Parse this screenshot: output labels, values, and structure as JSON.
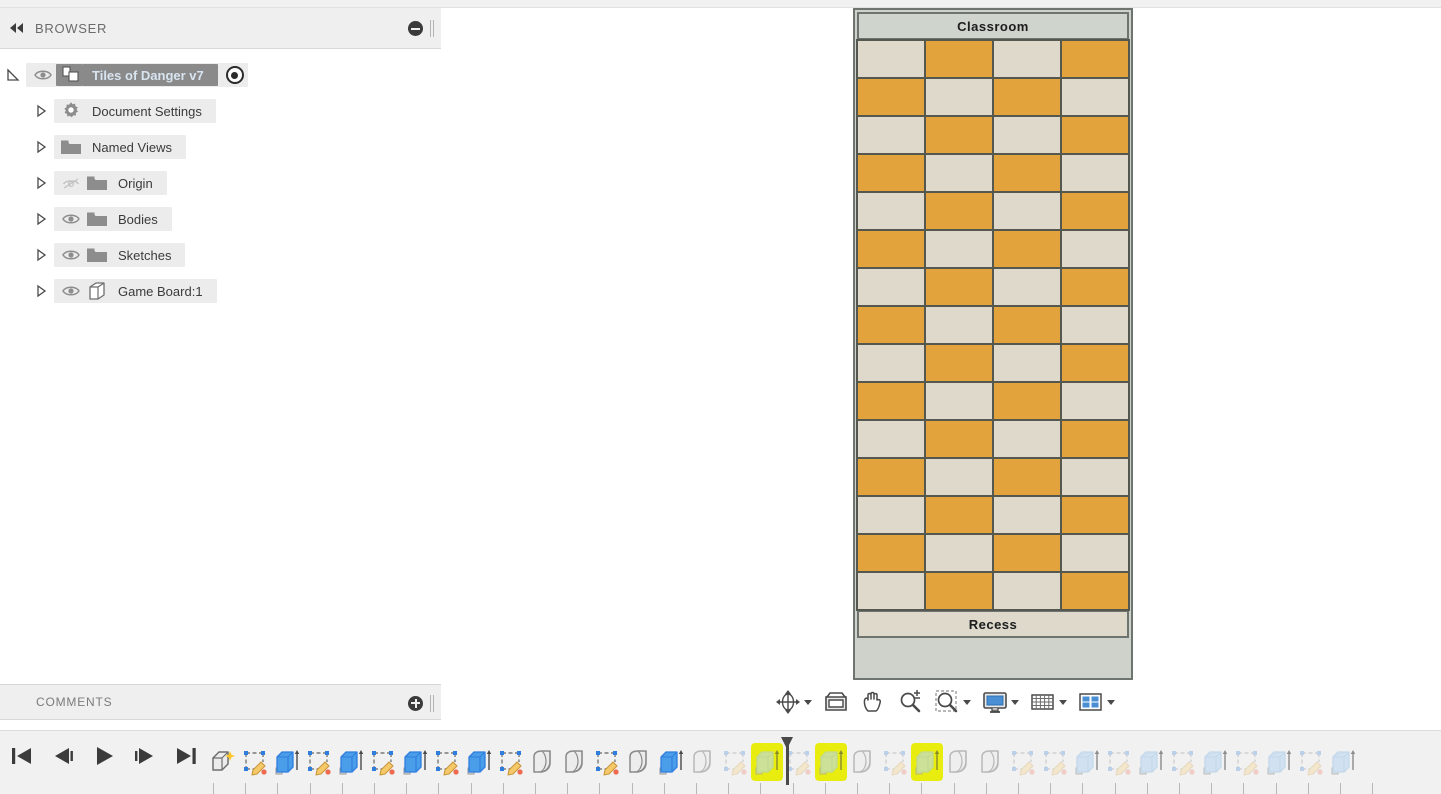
{
  "app": {
    "browser_panel_title": "BROWSER",
    "comments_title": "COMMENTS"
  },
  "browser": {
    "collapse_icon": "double-left-arrows-icon",
    "minimize_icon": "minus-circle-icon",
    "grip_icon": "panel-grip-icon",
    "root": {
      "label": "Tiles of Danger v7",
      "icon": "component-icon",
      "visibility_icon": "eye-visible-icon",
      "expanded": true,
      "activate_icon": "target-dot-icon"
    },
    "items": [
      {
        "label": "Document Settings",
        "icon": "gear-icon",
        "has_eye": false,
        "eye_state": "none"
      },
      {
        "label": "Named Views",
        "icon": "folder-icon",
        "has_eye": false,
        "eye_state": "none"
      },
      {
        "label": "Origin",
        "icon": "folder-icon",
        "has_eye": true,
        "eye_state": "hidden"
      },
      {
        "label": "Bodies",
        "icon": "folder-icon",
        "has_eye": true,
        "eye_state": "visible"
      },
      {
        "label": "Sketches",
        "icon": "folder-icon",
        "has_eye": true,
        "eye_state": "visible"
      },
      {
        "label": "Game Board:1",
        "icon": "body-cube-icon",
        "has_eye": true,
        "eye_state": "visible"
      }
    ]
  },
  "comments": {
    "add_icon": "plus-circle-icon",
    "grip_icon": "panel-grip-icon"
  },
  "board": {
    "top_label": "Classroom",
    "bottom_label": "Recess",
    "columns": 4,
    "rows": 15,
    "colors": {
      "light_tile": "#ded9cb",
      "dark_tile": "#e3a33c",
      "band": "#cfd5cd",
      "band_bottom": "#ded9cb",
      "frame": "#6e7570",
      "cell_border": "#55584f"
    },
    "pattern": [
      [
        "light",
        "dark",
        "light",
        "dark"
      ],
      [
        "dark",
        "light",
        "dark",
        "light"
      ],
      [
        "light",
        "dark",
        "light",
        "dark"
      ],
      [
        "dark",
        "light",
        "dark",
        "light"
      ],
      [
        "light",
        "dark",
        "light",
        "dark"
      ],
      [
        "dark",
        "light",
        "dark",
        "light"
      ],
      [
        "light",
        "dark",
        "light",
        "dark"
      ],
      [
        "dark",
        "light",
        "dark",
        "light"
      ],
      [
        "light",
        "dark",
        "light",
        "dark"
      ],
      [
        "dark",
        "light",
        "dark",
        "light"
      ],
      [
        "light",
        "dark",
        "light",
        "dark"
      ],
      [
        "dark",
        "light",
        "dark",
        "light"
      ],
      [
        "light",
        "dark",
        "light",
        "dark"
      ],
      [
        "dark",
        "light",
        "dark",
        "light"
      ],
      [
        "light",
        "dark",
        "light",
        "dark"
      ]
    ]
  },
  "navbar": {
    "buttons": [
      {
        "name": "orbit-icon",
        "label": "Orbit",
        "has_caret": true
      },
      {
        "name": "look-at-icon",
        "label": "Look At",
        "has_caret": false
      },
      {
        "name": "pan-hand-icon",
        "label": "Pan",
        "has_caret": false
      },
      {
        "name": "zoom-magnifier-icon",
        "label": "Zoom",
        "has_caret": false
      },
      {
        "name": "zoom-window-icon",
        "label": "Zoom Window",
        "has_caret": true
      },
      {
        "name": "display-settings-monitor-icon",
        "label": "Display Settings",
        "has_caret": true
      },
      {
        "name": "grid-snaps-icon",
        "label": "Grid and Snaps",
        "has_caret": true
      },
      {
        "name": "viewports-icon",
        "label": "Viewports",
        "has_caret": true
      }
    ]
  },
  "timeline": {
    "playback": [
      {
        "name": "go-to-beginning-icon",
        "label": "Go to Beginning"
      },
      {
        "name": "step-back-icon",
        "label": "Step Back"
      },
      {
        "name": "play-icon",
        "label": "Play"
      },
      {
        "name": "step-forward-icon",
        "label": "Step Forward"
      },
      {
        "name": "go-to-end-icon",
        "label": "Go to End"
      }
    ],
    "playhead_index": 18,
    "features": [
      {
        "type": "new-component",
        "state": "normal",
        "highlighted": false
      },
      {
        "type": "sketch",
        "state": "normal",
        "highlighted": false
      },
      {
        "type": "extrude",
        "state": "normal",
        "highlighted": false
      },
      {
        "type": "sketch",
        "state": "normal",
        "highlighted": false
      },
      {
        "type": "extrude",
        "state": "normal",
        "highlighted": false
      },
      {
        "type": "sketch",
        "state": "normal",
        "highlighted": false
      },
      {
        "type": "extrude",
        "state": "normal",
        "highlighted": false
      },
      {
        "type": "sketch",
        "state": "normal",
        "highlighted": false
      },
      {
        "type": "extrude",
        "state": "normal",
        "highlighted": false
      },
      {
        "type": "sketch",
        "state": "normal",
        "highlighted": false
      },
      {
        "type": "fillet",
        "state": "normal",
        "highlighted": false
      },
      {
        "type": "fillet",
        "state": "normal",
        "highlighted": false
      },
      {
        "type": "sketch",
        "state": "normal",
        "highlighted": false
      },
      {
        "type": "fillet",
        "state": "normal",
        "highlighted": false
      },
      {
        "type": "extrude",
        "state": "normal",
        "highlighted": false
      },
      {
        "type": "fillet",
        "state": "faded",
        "highlighted": false
      },
      {
        "type": "sketch",
        "state": "faded",
        "highlighted": false
      },
      {
        "type": "extrude",
        "state": "faded",
        "highlighted": true
      },
      {
        "type": "sketch",
        "state": "faded",
        "highlighted": false
      },
      {
        "type": "extrude",
        "state": "faded",
        "highlighted": true
      },
      {
        "type": "fillet",
        "state": "faded",
        "highlighted": false
      },
      {
        "type": "sketch",
        "state": "faded",
        "highlighted": false
      },
      {
        "type": "extrude",
        "state": "faded",
        "highlighted": true
      },
      {
        "type": "fillet",
        "state": "faded",
        "highlighted": false
      },
      {
        "type": "fillet",
        "state": "faded",
        "highlighted": false
      },
      {
        "type": "sketch",
        "state": "faded",
        "highlighted": false
      },
      {
        "type": "sketch",
        "state": "faded",
        "highlighted": false
      },
      {
        "type": "extrude",
        "state": "faded",
        "highlighted": false
      },
      {
        "type": "sketch",
        "state": "faded",
        "highlighted": false
      },
      {
        "type": "extrude",
        "state": "faded",
        "highlighted": false
      },
      {
        "type": "sketch",
        "state": "faded",
        "highlighted": false
      },
      {
        "type": "extrude",
        "state": "faded",
        "highlighted": false
      },
      {
        "type": "sketch",
        "state": "faded",
        "highlighted": false
      },
      {
        "type": "extrude",
        "state": "faded",
        "highlighted": false
      },
      {
        "type": "sketch",
        "state": "faded",
        "highlighted": false
      },
      {
        "type": "extrude",
        "state": "faded",
        "highlighted": false
      }
    ]
  }
}
